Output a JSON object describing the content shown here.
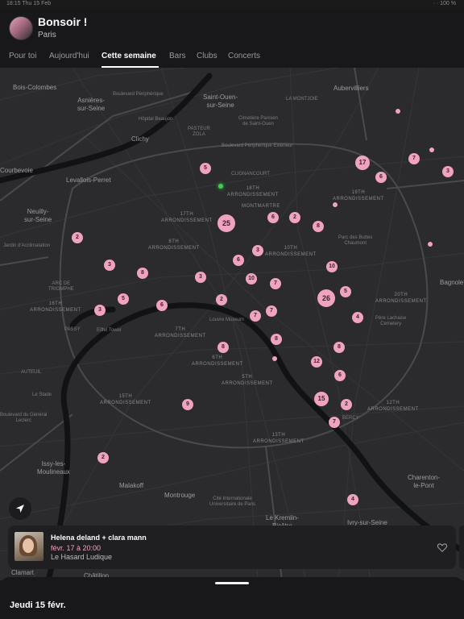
{
  "status_bar": {
    "time": "18:15  Thu 15 Feb",
    "right": "· · 100 %"
  },
  "header": {
    "greeting": "Bonsoir !",
    "city": "Paris"
  },
  "tabs": [
    {
      "label": "Pour toi",
      "active": false
    },
    {
      "label": "Aujourd'hui",
      "active": false
    },
    {
      "label": "Cette semaine",
      "active": true
    },
    {
      "label": "Bars",
      "active": false
    },
    {
      "label": "Clubs",
      "active": false
    },
    {
      "label": "Concerts",
      "active": false
    }
  ],
  "map": {
    "places": [
      "Bois-Colombes",
      "Asnières-\nsur-Seine",
      "Saint-Ouen-\nsur-Seine",
      "Aubervilliers",
      "Clichy",
      "Levallois-Perret",
      "Courbevoie",
      "Neuilly-\nsur-Seine",
      "Bagnolet",
      "Issy-les-\nMoulineaux",
      "Malakoff",
      "Montrouge",
      "Charenton-\nle-Pont",
      "Le Kremlin-\nBicêtre",
      "Ivry-sur-Seine",
      "Clamart",
      "Châtillon"
    ],
    "small_labels": [
      "Hôpital Beaujon",
      "Cimetière Parisien\nde Saint-Ouen",
      "PASTEUR\nZOLA",
      "LA MONTJOIE",
      "Boulevard Périphérique Extérieur",
      "Parc des Buttes\nChaumont",
      "Louvre Museum",
      "Eiffel Tower",
      "Père Lachaise\nCemetery",
      "Cité Internationale\nUniversitaire de Paris",
      "Jardin d'Acclimatation",
      "AUTEUIL",
      "PASSY",
      "BERCY",
      "Boulevard Périphérique",
      "CLIGNANCOURT",
      "ARC DE\nTRIOMPHE",
      "Le Stade",
      "Boulevard du Général\nLeclerc"
    ],
    "arrondissements": [
      "18TH\nARRONDISSEMENT",
      "19TH\nARRONDISSEMENT",
      "17TH\nARRONDISSEMENT",
      "8TH\nARRONDISSEMENT",
      "10TH\nARRONDISSEMENT",
      "20TH\nARRONDISSEMENT",
      "16TH\nARRONDISSEMENT",
      "7TH\nARRONDISSEMENT",
      "6TH\nARRONDISSEMENT",
      "5TH\nARRONDISSEMENT",
      "15TH\nARRONDISSEMENT",
      "12TH\nARRONDISSEMENT",
      "13TH\nARRONDISSEMENT",
      "MONTMARTRE"
    ],
    "pins": [
      "5",
      "17",
      "6",
      "7",
      "3",
      "25",
      "6",
      "2",
      "8",
      "2",
      "6",
      "3",
      "3",
      "8",
      "10",
      "3",
      "5",
      "2",
      "10",
      "7",
      "6",
      "5",
      "26",
      "4",
      "7",
      "7",
      "3",
      "8",
      "8",
      "12",
      "6",
      "15",
      "2",
      "7",
      "9",
      "2",
      "4"
    ]
  },
  "event_card": {
    "title": "Helena deland + clara mann",
    "date": "févr. 17 à 20:00",
    "venue": "Le Hasard Ludique",
    "colors": {
      "accent": "#f0a3c0"
    }
  },
  "sheet": {
    "date_heading": "Jeudi 15 févr."
  },
  "icons": [
    "locate-arrow-icon",
    "heart-icon"
  ]
}
